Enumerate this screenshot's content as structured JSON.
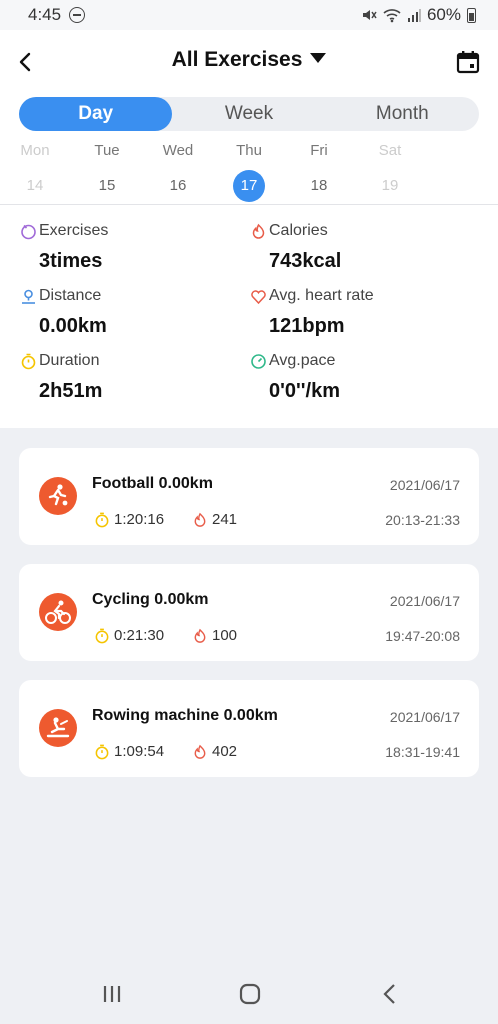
{
  "status": {
    "time": "4:45",
    "battery": "60%"
  },
  "header": {
    "title": "All Exercises"
  },
  "tabs": [
    {
      "label": "Day",
      "active": true
    },
    {
      "label": "Week",
      "active": false
    },
    {
      "label": "Month",
      "active": false
    }
  ],
  "week": [
    {
      "name": "Mon",
      "num": "14",
      "state": "faded"
    },
    {
      "name": "Tue",
      "num": "15",
      "state": ""
    },
    {
      "name": "Wed",
      "num": "16",
      "state": ""
    },
    {
      "name": "Thu",
      "num": "17",
      "state": "sel"
    },
    {
      "name": "Fri",
      "num": "18",
      "state": ""
    },
    {
      "name": "Sat",
      "num": "19",
      "state": "faded"
    }
  ],
  "stats": {
    "exercises": {
      "label": "Exercises",
      "value": "3times"
    },
    "calories": {
      "label": "Calories",
      "value": "743kcal"
    },
    "distance": {
      "label": "Distance",
      "value": "0.00km"
    },
    "heart": {
      "label": "Avg. heart rate",
      "value": "121bpm"
    },
    "duration": {
      "label": "Duration",
      "value": "2h51m"
    },
    "pace": {
      "label": "Avg.pace",
      "value": "0'0''/km"
    }
  },
  "records": [
    {
      "name": "Football 0.00km",
      "date": "2021/06/17",
      "duration": "1:20:16",
      "calories": "241",
      "range": "20:13-21:33",
      "icon": "football-icon"
    },
    {
      "name": "Cycling 0.00km",
      "date": "2021/06/17",
      "duration": "0:21:30",
      "calories": "100",
      "range": "19:47-20:08",
      "icon": "cycling-icon"
    },
    {
      "name": "Rowing machine 0.00km",
      "date": "2021/06/17",
      "duration": "1:09:54",
      "calories": "402",
      "range": "18:31-19:41",
      "icon": "rowing-icon"
    }
  ],
  "colors": {
    "accent": "#3a8ff0",
    "activity": "#ee5a2f",
    "duration": "#f5c400",
    "calories": "#e85d4a"
  }
}
